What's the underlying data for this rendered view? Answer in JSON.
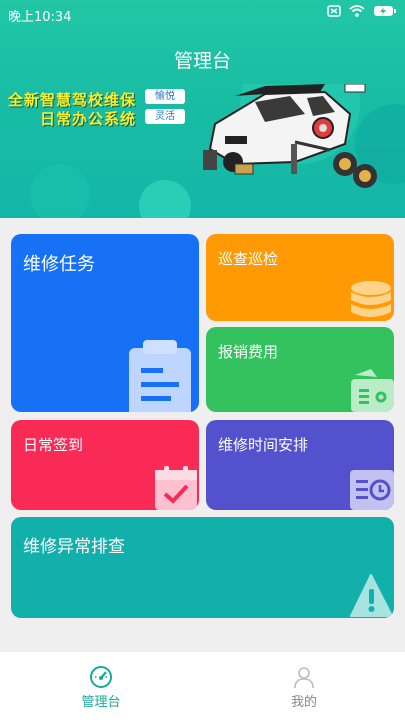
{
  "status_bar": {
    "time": "晚上10:34"
  },
  "app": {
    "title": "管理台"
  },
  "banner": {
    "line1": "全新智慧驾校维保",
    "line2": "日常办公系统",
    "tag1": "愉悦",
    "tag2": "灵活"
  },
  "tiles": {
    "repair_task": "维修任务",
    "patrol": "巡查巡检",
    "reimburse": "报销费用",
    "checkin": "日常签到",
    "schedule": "维修时间安排",
    "anomaly": "维修异常排查"
  },
  "colors": {
    "header": "#1cbfa6",
    "repair_task": "#1671f7",
    "patrol": "#ff9a05",
    "reimburse": "#33c25d",
    "checkin": "#f92a55",
    "schedule": "#5451ce",
    "anomaly": "#13afaa",
    "nav_active": "#16a99c",
    "nav_inactive": "#888888"
  },
  "icons": {
    "repair_task": "clipboard-icon",
    "patrol": "database-icon",
    "reimburse": "wallet-icon",
    "checkin": "calendar-check-icon",
    "schedule": "clock-card-icon",
    "anomaly": "warning-icon",
    "nav_admin": "gauge-icon",
    "nav_mine": "user-icon"
  },
  "nav": {
    "admin": "管理台",
    "mine": "我的"
  }
}
